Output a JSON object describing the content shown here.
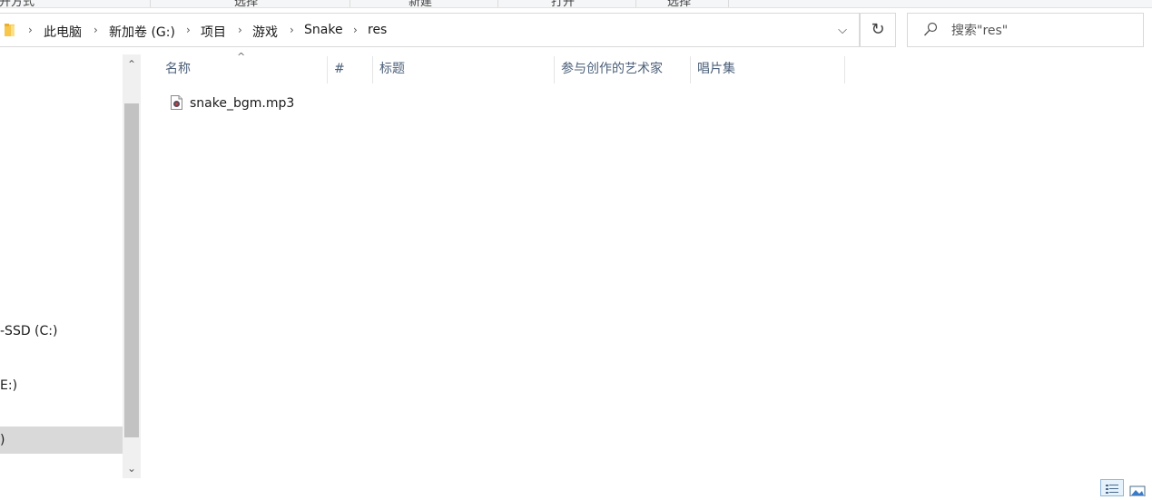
{
  "ribbon": {
    "tabs": [
      "打开方式",
      "选择",
      "新建",
      "打开",
      "选择"
    ]
  },
  "address": {
    "breadcrumbs": [
      "此电脑",
      "新加卷 (G:)",
      "项目",
      "游戏",
      "Snake",
      "res"
    ]
  },
  "search": {
    "placeholder": "搜索\"res\""
  },
  "nav_pane": {
    "items": [
      {
        "label": "-SSD (C:)",
        "selected": false
      },
      {
        "label": "E:)",
        "selected": false
      },
      {
        "label": ")",
        "selected": true
      }
    ]
  },
  "file_list": {
    "columns": [
      "名称",
      "#",
      "标题",
      "参与创作的艺术家",
      "唱片集"
    ],
    "sort_indicator": "^",
    "rows": [
      {
        "name": "snake_bgm.mp3",
        "icon": "mp3-file-icon"
      }
    ]
  },
  "icons": {
    "refresh": "↻",
    "dropdown": "⌵",
    "chevron": "›",
    "scroll_up": "⌃",
    "scroll_down": "⌄"
  },
  "colors": {
    "column_header_text": "#4c607a",
    "selected_nav_bg": "#d9d9d9",
    "active_view_border": "#8fb6d9"
  }
}
